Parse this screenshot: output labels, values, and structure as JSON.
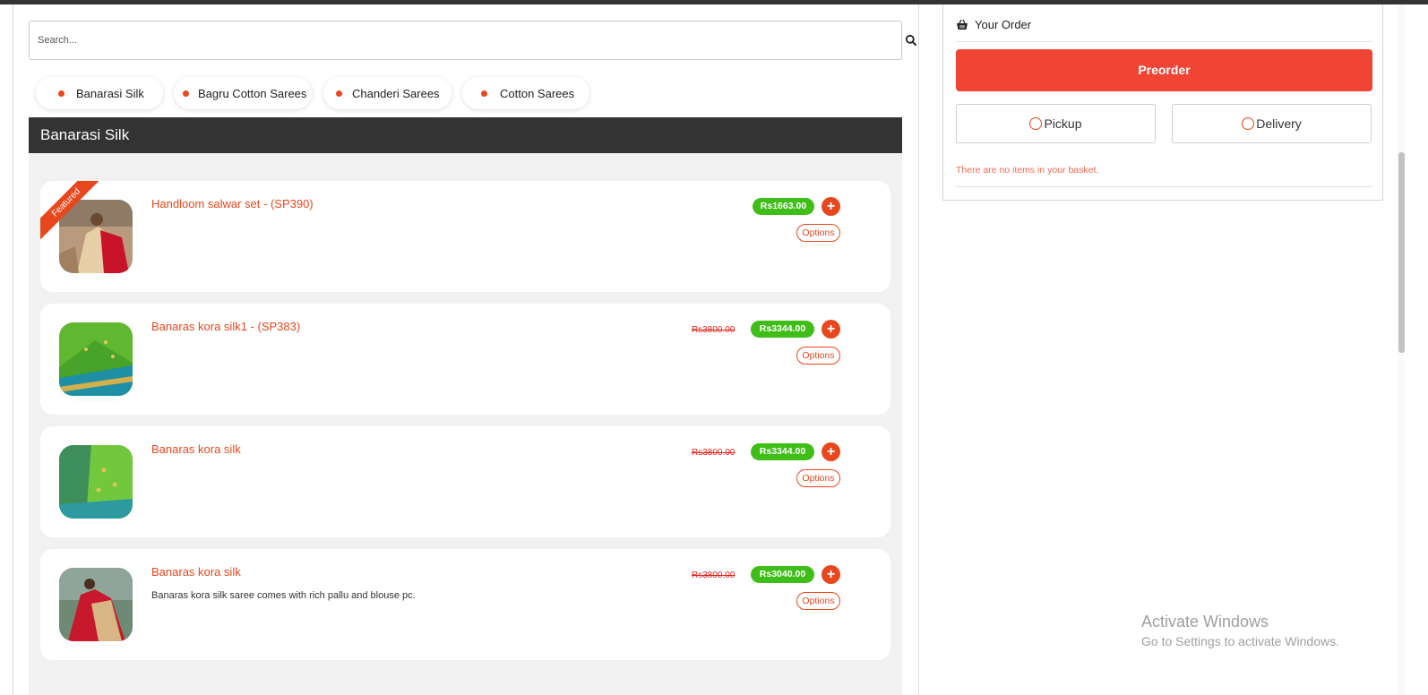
{
  "search": {
    "placeholder": "Search..."
  },
  "categories": [
    {
      "label": "Banarasi Silk"
    },
    {
      "label": "Bagru Cotton Sarees"
    },
    {
      "label": "Chanderi Sarees"
    },
    {
      "label": "Cotton Sarees"
    }
  ],
  "section": {
    "title": "Banarasi Silk"
  },
  "products": [
    {
      "title": "Handloom salwar set - (SP390)",
      "badge": "Featured",
      "price": "Rs1663.00",
      "old_price": "",
      "description": "",
      "options_label": "Options",
      "add_label": "+"
    },
    {
      "title": "Banaras kora silk1 - (SP383)",
      "badge": "",
      "price": "Rs3344.00",
      "old_price": "Rs3800.00",
      "description": "",
      "options_label": "Options",
      "add_label": "+"
    },
    {
      "title": "Banaras kora silk",
      "badge": "",
      "price": "Rs3344.00",
      "old_price": "Rs3800.00",
      "description": "",
      "options_label": "Options",
      "add_label": "+"
    },
    {
      "title": "Banaras kora silk",
      "badge": "",
      "price": "Rs3040.00",
      "old_price": "Rs3800.00",
      "description": "Banaras kora silk saree comes with rich pallu and blouse pc.",
      "options_label": "Options",
      "add_label": "+"
    }
  ],
  "order": {
    "title": "Your Order",
    "preorder_label": "Preorder",
    "pickup_label": "Pickup",
    "delivery_label": "Delivery",
    "empty_message": "There are no items in your basket."
  },
  "watermark": {
    "title": "Activate Windows",
    "subtitle": "Go to Settings to activate Windows."
  },
  "colors": {
    "accent": "#e8471d",
    "price_green": "#3fbe17",
    "preorder_red": "#f04435",
    "header_dark": "#333333"
  },
  "icons": {
    "search": "search-icon",
    "basket": "basket-icon",
    "add": "plus-circle-icon"
  }
}
